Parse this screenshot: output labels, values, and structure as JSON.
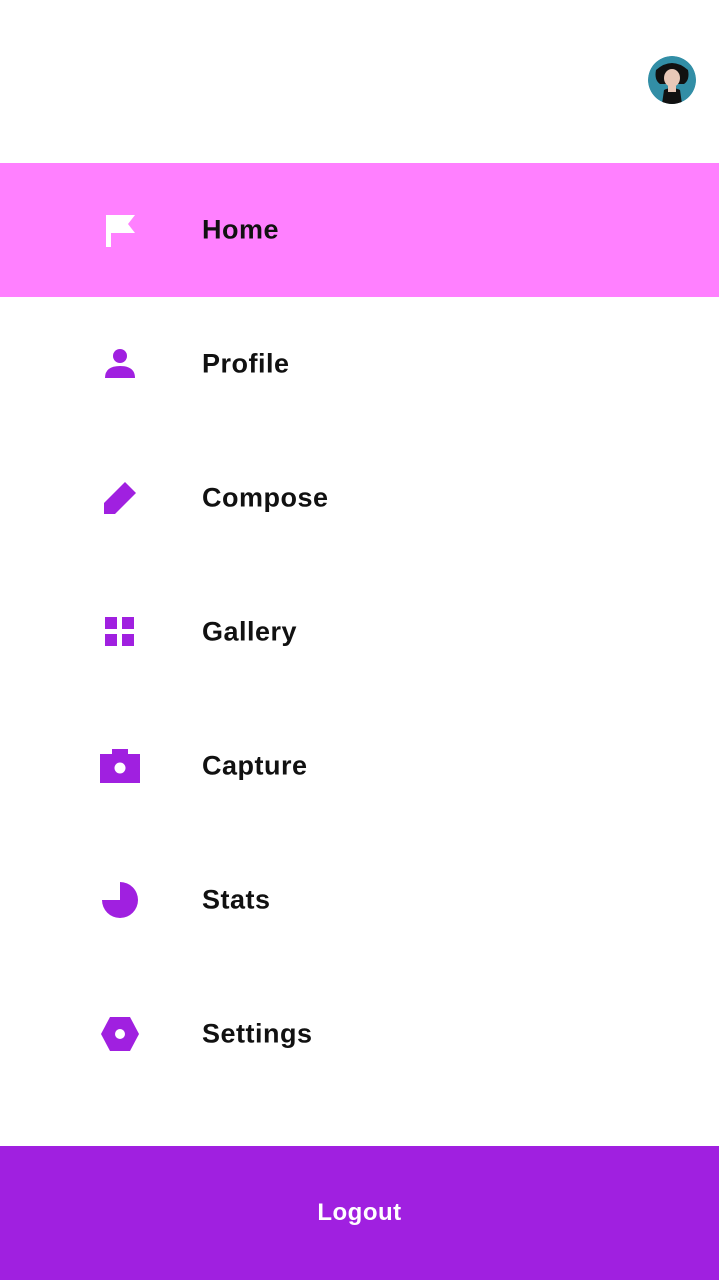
{
  "colors": {
    "accent": "#a020e0",
    "active_background": "#ff80ff",
    "active_icon": "#ffffff",
    "text": "#111111"
  },
  "header": {
    "avatar_icon": "user-avatar"
  },
  "menu": {
    "items": [
      {
        "label": "Home",
        "icon": "flag-icon",
        "active": true
      },
      {
        "label": "Profile",
        "icon": "person-icon",
        "active": false
      },
      {
        "label": "Compose",
        "icon": "pencil-icon",
        "active": false
      },
      {
        "label": "Gallery",
        "icon": "grid-icon",
        "active": false
      },
      {
        "label": "Capture",
        "icon": "camera-icon",
        "active": false
      },
      {
        "label": "Stats",
        "icon": "pie-chart-icon",
        "active": false
      },
      {
        "label": "Settings",
        "icon": "hexagon-settings-icon",
        "active": false
      }
    ]
  },
  "footer": {
    "logout_label": "Logout"
  }
}
